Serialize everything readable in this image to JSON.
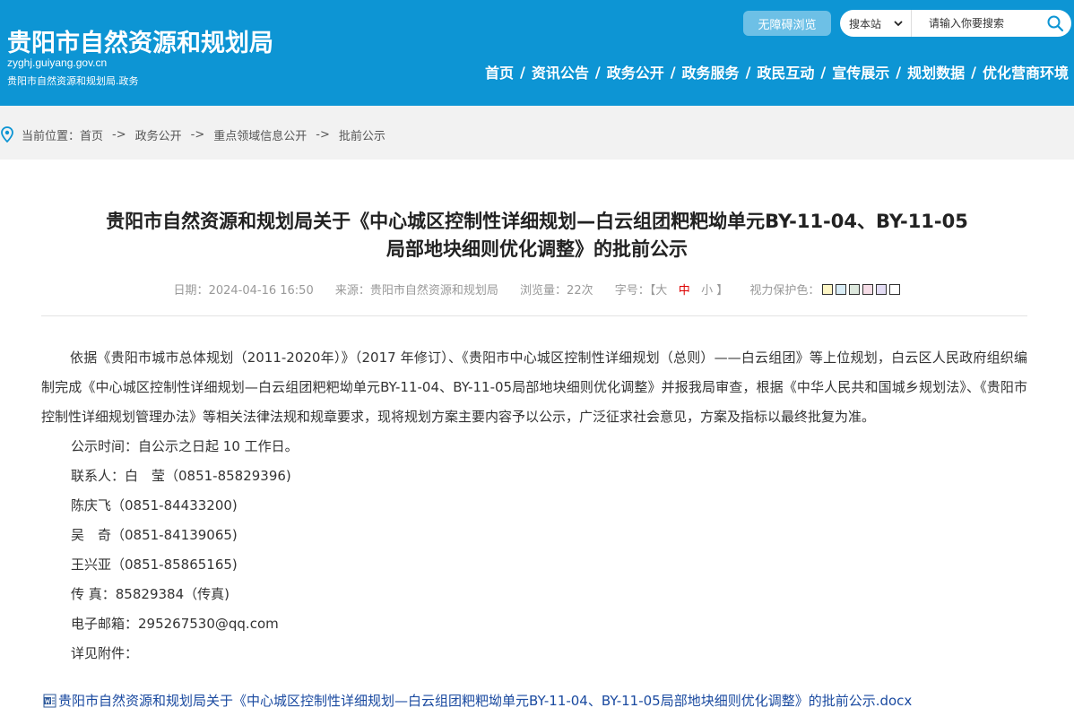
{
  "header": {
    "site_title": "贵阳市自然资源和规划局",
    "domain": "zyghj.guiyang.gov.cn",
    "subtitle": "贵阳市自然资源和规划局.政务",
    "accessibility_label": "无障碍浏览",
    "search": {
      "scope_selected": "搜本站",
      "placeholder": "请输入你要搜索"
    },
    "nav": [
      "首页",
      "资讯公告",
      "政务公开",
      "政务服务",
      "政民互动",
      "宣传展示",
      "规划数据",
      "优化营商环境"
    ],
    "nav_separator": "/"
  },
  "breadcrumb": {
    "prefix": "当前位置：",
    "items": [
      "首页",
      "政务公开",
      "重点领域信息公开",
      "批前公示"
    ],
    "arrow": "->"
  },
  "article": {
    "title_line1": "贵阳市自然资源和规划局关于《中心城区控制性详细规划—白云组团粑粑坳单元BY-11-04、BY-11-05",
    "title_line2": "局部地块细则优化调整》的批前公示",
    "meta": {
      "date_label": "日期：",
      "date": "2024-04-16 16:50",
      "source_label": "来源：",
      "source": "贵阳市自然资源和规划局",
      "views_label": "浏览量：",
      "views": "22次",
      "fontsize_label": "字号：",
      "bracket_open": "【",
      "size_large": "大",
      "size_medium": "中",
      "size_small": "小",
      "bracket_close": "】",
      "eye_care_label": "视力保护色：",
      "swatch_colors": [
        "#fdf6c5",
        "#d8ecf6",
        "#dde8dd",
        "#f6dde7",
        "#e3dcf4",
        "#ffffff"
      ]
    },
    "paragraph": "依据《贵阳市城市总体规划（2011-2020年）》（2017 年修订）、《贵阳市中心城区控制性详细规划（总则）——白云组团》等上位规划，白云区人民政府组织编制完成《中心城区控制性详细规划—白云组团粑粑坳单元BY-11-04、BY-11-05局部地块细则优化调整》并报我局审查，根据《中华人民共和国城乡规划法》、《贵阳市控制性详细规划管理办法》等相关法律法规和规章要求，现将规划方案主要内容予以公示，广泛征求社会意见，方案及指标以最终批复为准。",
    "lines": [
      "公示时间：自公示之日起 10 工作日。",
      "联系人：白　莹（0851-85829396)",
      "陈庆飞（0851-84433200)",
      "吴　奇（0851-84139065)",
      "王兴亚（0851-85865165)",
      "传 真：85829384（传真)",
      "电子邮箱：295267530@qq.com",
      "详见附件："
    ],
    "attachment": "贵阳市自然资源和规划局关于《中心城区控制性详细规划—白云组团粑粑坳单元BY-11-04、BY-11-05局部地块细则优化调整》的批前公示.docx"
  },
  "colors": {
    "header_bg": "#0d95d4",
    "accent_red": "#d00000",
    "link": "#1a4aa0"
  }
}
